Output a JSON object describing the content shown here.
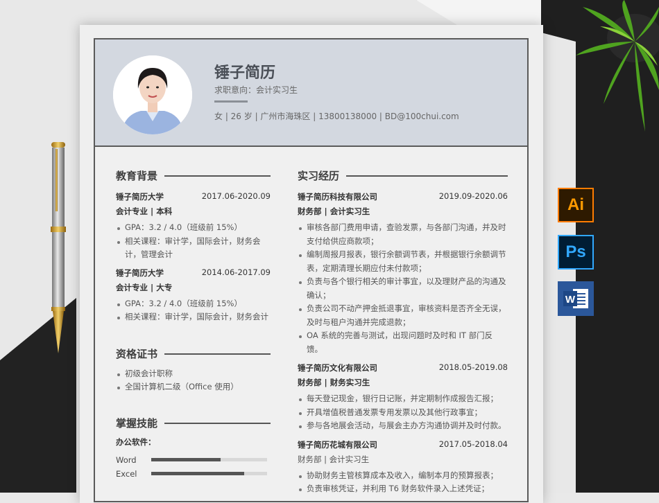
{
  "resume": {
    "name": "锤子简历",
    "intent": "求职意向：会计实习生",
    "contact": "女 | 26 岁 | 广州市海珠区 | 13800138000 | BD@100chui.com"
  },
  "education": {
    "title": "教育背景",
    "entries": [
      {
        "school": "锤子简历大学",
        "date": "2017.06-2020.09",
        "major": "会计专业 | 本科",
        "items": [
          "GPA：3.2 / 4.0（班级前 15%）",
          "相关课程：审计学，国际会计，财务会计，管理会计"
        ]
      },
      {
        "school": "锤子简历大学",
        "date": "2014.06-2017.09",
        "major": "会计专业 | 大专",
        "items": [
          "GPA：3.2 / 4.0（班级前 15%）",
          "相关课程：审计学，国际会计，财务会计"
        ]
      }
    ]
  },
  "certificates": {
    "title": "资格证书",
    "items": [
      "初级会计职称",
      "全国计算机二级（Office 使用）"
    ]
  },
  "skills": {
    "title": "掌握技能",
    "subtitle": "办公软件：",
    "items": [
      {
        "label": "Word",
        "level": 0.6
      },
      {
        "label": "Excel",
        "level": 0.8
      }
    ]
  },
  "experience": {
    "title": "实习经历",
    "entries": [
      {
        "company": "锤子简历科技有限公司",
        "date": "2019.09-2020.06",
        "role": "财务部 | 会计实习生",
        "items": [
          "审核各部门费用申请，查验发票，与各部门沟通，并及时支付给供应商款项；",
          "编制周报月报表，银行余额调节表，并根据银行余额调节表，定期清理长期应付未付款项；",
          "负责与各个银行相关的审计事宜，以及理财产品的沟通及确认；",
          "负责公司不动产押金抵退事宜，审核资料是否齐全无误，及时与租户沟通并完成退款；",
          "OA 系统的完善与测试，出现问题时及时和 IT 部门反馈。"
        ]
      },
      {
        "company": "锤子简历文化有限公司",
        "date": "2018.05-2019.08",
        "role": "财务部 | 财务实习生",
        "items": [
          "每天登记现金，银行日记账，并定期制作成报告汇报；",
          "开具增值税普通发票专用发票以及其他行政事宜；",
          "参与各地展会活动，与展会主办方沟通协调并及时付款。"
        ]
      },
      {
        "company": "锤子简历花城有限公司",
        "date": "2017.05-2018.04",
        "role": "财务部 | 会计实习生",
        "items": [
          "协助财务主管核算成本及收入，编制本月的预算报表；",
          "负责审核凭证，并利用 T6 财务软件录入上述凭证；"
        ]
      }
    ]
  },
  "apps": {
    "ai": "Ai",
    "ps": "Ps",
    "word": "W"
  },
  "colors": {
    "header_bg": "#d3d8e0",
    "dark_bg": "#1c1c1c",
    "ai": "#ff7c00",
    "ps": "#31a8ff",
    "word": "#2b579a"
  }
}
